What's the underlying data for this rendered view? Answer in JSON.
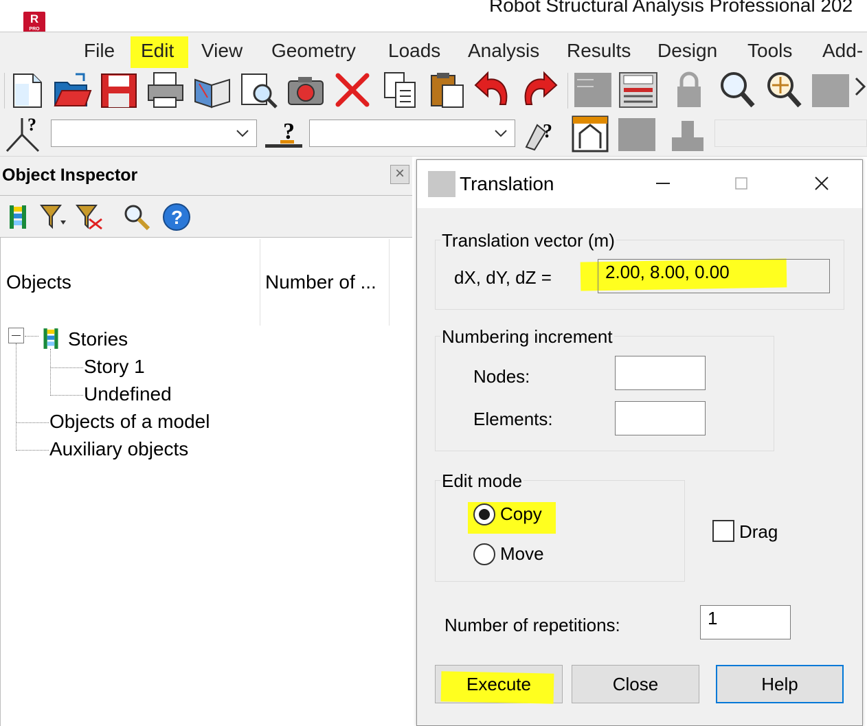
{
  "app": {
    "title": "Robot Structural Analysis Professional 202",
    "logo_letter": "R",
    "logo_badge": "PRO"
  },
  "menu": {
    "items": [
      "File",
      "Edit",
      "View",
      "Geometry",
      "Loads",
      "Analysis",
      "Results",
      "Design",
      "Tools",
      "Add-"
    ],
    "highlighted": "Edit"
  },
  "toolbar1": {
    "icons": [
      "new-file-icon",
      "open-folder-icon",
      "save-icon",
      "print-icon",
      "print-preview-icon",
      "screen-capture-icon",
      "camera-icon",
      "delete-icon",
      "copy-icon",
      "paste-icon",
      "undo-icon",
      "redo-icon",
      "table-icon",
      "calculator-icon",
      "lock-icon",
      "zoom-icon",
      "pan-zoom-icon",
      "view-3d-icon"
    ]
  },
  "toolbar2": {
    "combo1_value": "",
    "combo2_value": ""
  },
  "inspector": {
    "title": "Object Inspector",
    "close_label": "×",
    "columns": [
      "Objects",
      "Number of ..."
    ],
    "tree": {
      "root": "Stories",
      "children": [
        "Story 1",
        "Undefined"
      ],
      "siblings": [
        "Objects of a model",
        "Auxiliary objects"
      ]
    }
  },
  "dialog": {
    "title": "Translation",
    "vector_group": "Translation vector (m)",
    "vector_label": "dX, dY, dZ  =",
    "vector_value": "2.00, 8.00, 0.00",
    "numbering_group": "Numbering increment",
    "nodes_label": "Nodes:",
    "nodes_value": "",
    "elements_label": "Elements:",
    "elements_value": "",
    "edit_mode_group": "Edit mode",
    "copy_label": "Copy",
    "move_label": "Move",
    "selected_mode": "Copy",
    "drag_label": "Drag",
    "drag_checked": false,
    "repetitions_label": "Number of repetitions:",
    "repetitions_value": "1",
    "execute_label": "Execute",
    "close_label": "Close",
    "help_label": "Help"
  },
  "colors": {
    "highlight": "#ffff1f",
    "logo": "#c8102e",
    "focus_border": "#0078d7"
  }
}
